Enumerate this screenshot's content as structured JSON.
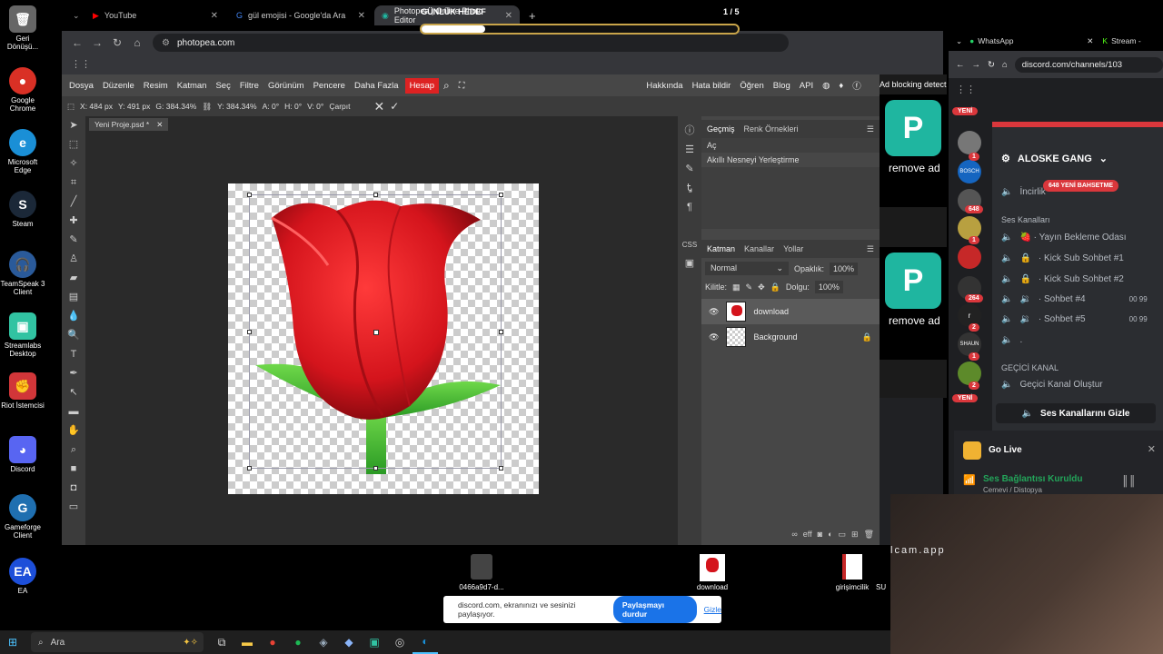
{
  "desktop": {
    "icons": [
      {
        "label": "Geri Dönüşü...",
        "icon": "recycle-bin-icon",
        "color": "#888"
      },
      {
        "label": "Google Chrome",
        "icon": "chrome-icon",
        "color": "#d93025"
      },
      {
        "label": "Microsoft Edge",
        "icon": "edge-icon",
        "color": "#1a8fd6"
      },
      {
        "label": "Steam",
        "icon": "steam-icon",
        "color": "#1b2838"
      },
      {
        "label": "TeamSpeak 3 Client",
        "icon": "teamspeak-icon",
        "color": "#2a5a9a"
      },
      {
        "label": "Streamlabs Desktop",
        "icon": "streamlabs-icon",
        "color": "#31c3a2"
      },
      {
        "label": "Riot İstemcisi",
        "icon": "riot-icon",
        "color": "#d13639"
      },
      {
        "label": "Discord",
        "icon": "discord-icon",
        "color": "#5865f2"
      },
      {
        "label": "Gameforge Client",
        "icon": "gameforge-icon",
        "color": "#1f6fb0"
      },
      {
        "label": "EA",
        "icon": "ea-icon",
        "color": "#1d4fd9"
      }
    ]
  },
  "browser": {
    "tabs": [
      {
        "label": "YouTube",
        "icon": "youtube-icon"
      },
      {
        "label": "gül emojisi - Google'da Ara",
        "icon": "google-icon"
      },
      {
        "label": "Photopea | Online Photo Editor",
        "icon": "photopea-icon"
      }
    ],
    "url": "photopea.com",
    "overlay_title": "GÜNLÜK HEDEF",
    "overlay_count": "1 / 5"
  },
  "photopea": {
    "menu": [
      "Dosya",
      "Düzenle",
      "Resim",
      "Katman",
      "Seç",
      "Filtre",
      "Görünüm",
      "Pencere",
      "Daha Fazla"
    ],
    "account": "Hesap",
    "right_menu": [
      "Hakkında",
      "Hata bildir",
      "Öğren",
      "Blog",
      "API"
    ],
    "options": {
      "x": "X: 484 px",
      "y": "Y: 491 px",
      "g": "G: 384.34%",
      "y2": "Y: 384.34%",
      "a": "A: 0°",
      "h": "H: 0°",
      "v": "V: 0°",
      "warp": "Çarpıt"
    },
    "doc_tab": "Yeni Proje.psd *",
    "history_tabs": [
      "Geçmiş",
      "Renk Örnekleri"
    ],
    "history_items": [
      "Aç",
      "Akıllı Nesneyi Yerleştirme"
    ],
    "layer_tabs": [
      "Katman",
      "Kanallar",
      "Yollar"
    ],
    "blend_mode": "Normal",
    "opacity_label": "Opaklık:",
    "opacity_value": "100%",
    "lock_label": "Kilitle:",
    "fill_label": "Dolgu:",
    "fill_value": "100%",
    "layers": [
      {
        "name": "download",
        "type": "image"
      },
      {
        "name": "Background",
        "type": "transparent"
      }
    ]
  },
  "ad": {
    "label": "Ad blocking detect",
    "text": "remove ad"
  },
  "whatsapp": {
    "tabs": [
      "WhatsApp",
      "Stream -"
    ],
    "url": "discord.com/channels/103"
  },
  "discord": {
    "server_name": "ALOSKE GANG",
    "new_badge": "YENİ",
    "new_messages_badge": "648 YENİ BAHSETME",
    "truncated_channel": "İncirlik",
    "voice_section": "Ses Kanalları",
    "voice_channels": [
      {
        "name": "🍓 · Yayın Bekleme Odası"
      },
      {
        "name": "· Kick Sub Sohbet #1"
      },
      {
        "name": "· Kick Sub Sohbet #2"
      },
      {
        "name": "· Sohbet #4",
        "count": "00 99"
      },
      {
        "name": "· Sohbet #5",
        "count": "00 99"
      },
      {
        "name": "."
      }
    ],
    "temp_section": "GEÇİCİ KANAL",
    "temp_channel": "Geçici Kanal Oluştur",
    "hide_button": "Ses Kanallarını Gizle",
    "go_live": "Go Live",
    "voice_status": "Ses Bağlantısı Kuruldu",
    "voice_location": "Cemevi / Distopya",
    "server_badges": [
      "1",
      "648",
      "1",
      "264",
      "2",
      "1",
      "2"
    ]
  },
  "desktop_files": [
    {
      "label": "0466a9d7-d..."
    },
    {
      "label": "download"
    },
    {
      "label": "girişimcilik"
    },
    {
      "label": "SU"
    }
  ],
  "share_bar": {
    "text": "discord.com, ekranınızı ve sesinizi paylaşıyor.",
    "stop_button": "Paylaşmayı durdur",
    "hide_link": "Gizle"
  },
  "taskbar": {
    "search_placeholder": "Ara"
  },
  "webcam": {
    "watermark": "lcam.app"
  }
}
